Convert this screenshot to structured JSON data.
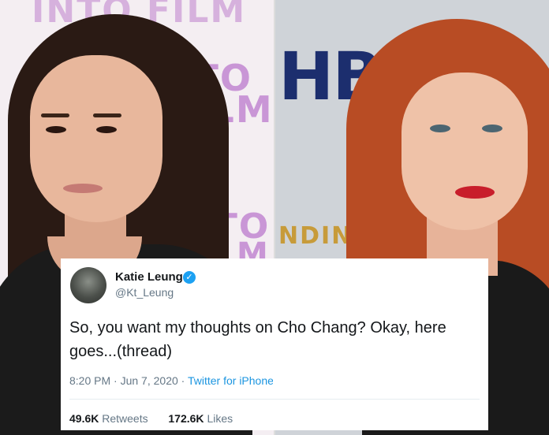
{
  "background_left": {
    "signage_top": "INTO FILM",
    "signage_nto": "NTO",
    "signage_film": "FILM",
    "signage_nto2": "NTO",
    "signage_m": "M"
  },
  "background_right": {
    "signage_logo": "HBO",
    "signage_partial": "NDING"
  },
  "tweet": {
    "author_name": "Katie Leung",
    "handle": "@Kt_Leung",
    "verified_icon": "✓",
    "text": "So, you want my thoughts on Cho Chang? Okay, here goes...(thread)",
    "time": "8:20 PM",
    "separator": " · ",
    "date": "Jun 7, 2020",
    "source": "Twitter for iPhone",
    "retweets_count": "49.6K",
    "retweets_label": "Retweets",
    "likes_count": "172.6K",
    "likes_label": "Likes"
  },
  "icons": {
    "verified": "verified-badge-icon",
    "avatar": "avatar-photo"
  },
  "colors": {
    "twitter_blue": "#1da1f2",
    "link_blue": "#1b95e0",
    "text_primary": "#14171a",
    "text_secondary": "#657786"
  }
}
